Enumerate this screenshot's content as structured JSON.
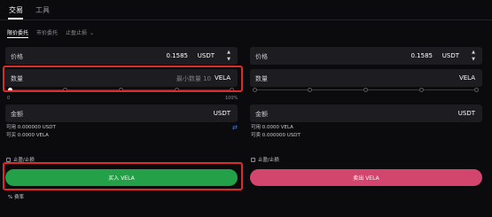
{
  "tabs": [
    "交易",
    "工具"
  ],
  "subtabs": {
    "limit": "限价委托",
    "market": "市价委托",
    "stop": "止盈止损"
  },
  "buy": {
    "price_label": "价格",
    "price_value": "0.1585",
    "price_unit": "USDT",
    "qty_label": "数量",
    "qty_placeholder": "最小数量 10",
    "qty_unit": "VELA",
    "pct_min": "0",
    "pct_max": "100%",
    "amount_label": "金额",
    "amount_unit": "USDT",
    "avail_usdt": "可用 0.000000 USDT",
    "avail_vela": "可买 0.0000 VELA",
    "tpsl": "止盈/止损",
    "action": "买入 VELA"
  },
  "sell": {
    "price_label": "价格",
    "price_value": "0.1585",
    "price_unit": "USDT",
    "qty_label": "数量",
    "qty_placeholder": "",
    "qty_unit": "VELA",
    "amount_label": "金额",
    "amount_unit": "USDT",
    "avail_vela": "可用 0.0000 VELA",
    "avail_usdt": "可卖 0.000000 USDT",
    "tpsl": "止盈/止损",
    "action": "卖出 VELA"
  },
  "fee_label": "费率",
  "colors": {
    "buy": "#24a148",
    "sell": "#d2456d",
    "highlight": "#dd2a2a"
  }
}
